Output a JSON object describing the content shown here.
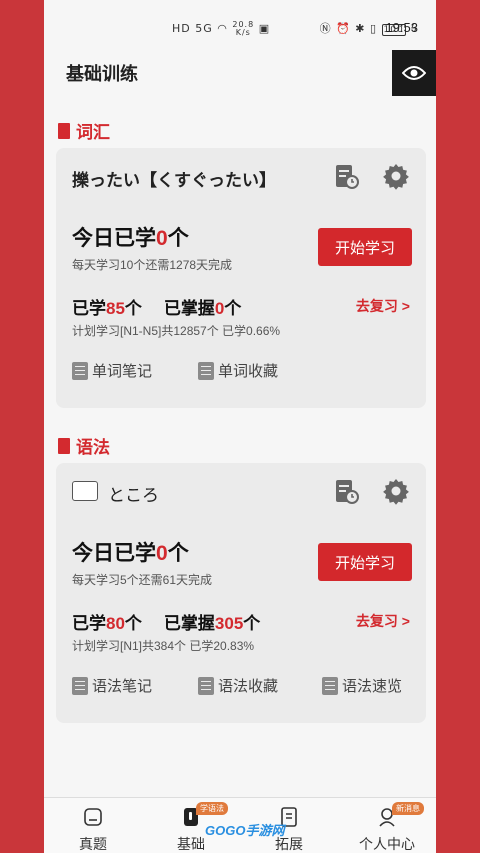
{
  "status_bar": {
    "left_icons": "HD 5G",
    "speed": "20.8",
    "speed_unit": "K/s",
    "battery": "100",
    "time": "19:53"
  },
  "header": {
    "title": "基础训练"
  },
  "vocab": {
    "section_title": "词汇",
    "word": "擽ったい【くすぐったい】",
    "today_prefix": "今日已学",
    "today_num": "0",
    "today_suffix": "个",
    "plan": "每天学习10个还需1278天完成",
    "start_label": "开始学习",
    "learned_prefix": "已学",
    "learned_num": "85",
    "learned_suffix": "个",
    "mastered_prefix": "已掌握",
    "mastered_num": "0",
    "mastered_suffix": "个",
    "review_label": "去复习 >",
    "progress": "计划学习[N1-N5]共12857个 已学0.66%",
    "tool1": "单词笔记",
    "tool2": "单词收藏"
  },
  "grammar": {
    "section_title": "语法",
    "word": "ところ",
    "today_prefix": "今日已学",
    "today_num": "0",
    "today_suffix": "个",
    "plan": "每天学习5个还需61天完成",
    "start_label": "开始学习",
    "learned_prefix": "已学",
    "learned_num": "80",
    "learned_suffix": "个",
    "mastered_prefix": "已掌握",
    "mastered_num": "305",
    "mastered_suffix": "个",
    "review_label": "去复习 >",
    "progress": "计划学习[N1]共384个 已学20.83%",
    "tool1": "语法笔记",
    "tool2": "语法收藏",
    "tool3": "语法速览"
  },
  "tabbar": {
    "tabs": [
      {
        "label": "真题"
      },
      {
        "label": "基础",
        "badge": "学语法"
      },
      {
        "label": "拓展"
      },
      {
        "label": "个人中心",
        "badge": "新消息"
      }
    ]
  },
  "watermark": "GOGO手游网",
  "colors": {
    "accent": "#d32a2f",
    "background_side": "#c9363a"
  }
}
